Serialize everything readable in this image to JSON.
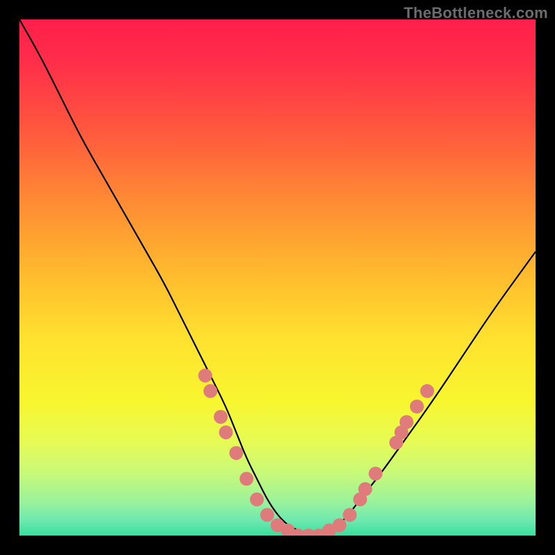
{
  "watermark": "TheBottleneck.com",
  "chart_data": {
    "type": "line",
    "title": "",
    "xlabel": "",
    "ylabel": "",
    "xlim": [
      0,
      100
    ],
    "ylim": [
      0,
      100
    ],
    "background_gradient_stops": [
      {
        "pos": 0.0,
        "color": "#ff1f4b"
      },
      {
        "pos": 0.08,
        "color": "#ff2d4a"
      },
      {
        "pos": 0.2,
        "color": "#ff533f"
      },
      {
        "pos": 0.35,
        "color": "#ff8a34"
      },
      {
        "pos": 0.5,
        "color": "#ffbd2e"
      },
      {
        "pos": 0.62,
        "color": "#ffe22f"
      },
      {
        "pos": 0.74,
        "color": "#f8f62f"
      },
      {
        "pos": 0.82,
        "color": "#e6fb55"
      },
      {
        "pos": 0.88,
        "color": "#c7f97a"
      },
      {
        "pos": 0.93,
        "color": "#9ff398"
      },
      {
        "pos": 0.97,
        "color": "#6fe9af"
      },
      {
        "pos": 1.0,
        "color": "#38df9d"
      }
    ],
    "series": [
      {
        "name": "bottleneck-curve",
        "color": "#000000",
        "x": [
          0,
          4,
          8,
          12,
          16,
          20,
          24,
          28,
          31,
          34,
          37,
          40,
          42,
          44,
          46,
          48,
          50,
          52,
          54,
          56,
          58,
          60,
          63,
          66,
          70,
          75,
          80,
          86,
          92,
          100
        ],
        "values": [
          100,
          93,
          85,
          77,
          70,
          63,
          56,
          49,
          43,
          37,
          31,
          25,
          20,
          15,
          11,
          7,
          4,
          2,
          1,
          0,
          0,
          1,
          3,
          7,
          12,
          19,
          26,
          35,
          44,
          55
        ]
      }
    ],
    "scatter": {
      "name": "data-points",
      "color": "#e07b7b",
      "radius": 10,
      "points": [
        {
          "x": 36,
          "y": 31
        },
        {
          "x": 37,
          "y": 28
        },
        {
          "x": 39,
          "y": 23
        },
        {
          "x": 40,
          "y": 20
        },
        {
          "x": 42,
          "y": 16
        },
        {
          "x": 44,
          "y": 11
        },
        {
          "x": 46,
          "y": 7
        },
        {
          "x": 48,
          "y": 4
        },
        {
          "x": 50,
          "y": 2
        },
        {
          "x": 52,
          "y": 1
        },
        {
          "x": 54,
          "y": 0
        },
        {
          "x": 56,
          "y": 0
        },
        {
          "x": 58,
          "y": 0
        },
        {
          "x": 60,
          "y": 1
        },
        {
          "x": 62,
          "y": 2
        },
        {
          "x": 64,
          "y": 4
        },
        {
          "x": 66,
          "y": 7
        },
        {
          "x": 67,
          "y": 9
        },
        {
          "x": 69,
          "y": 12
        },
        {
          "x": 73,
          "y": 18
        },
        {
          "x": 74,
          "y": 20
        },
        {
          "x": 75,
          "y": 22
        },
        {
          "x": 77,
          "y": 25
        },
        {
          "x": 79,
          "y": 28
        }
      ]
    }
  }
}
